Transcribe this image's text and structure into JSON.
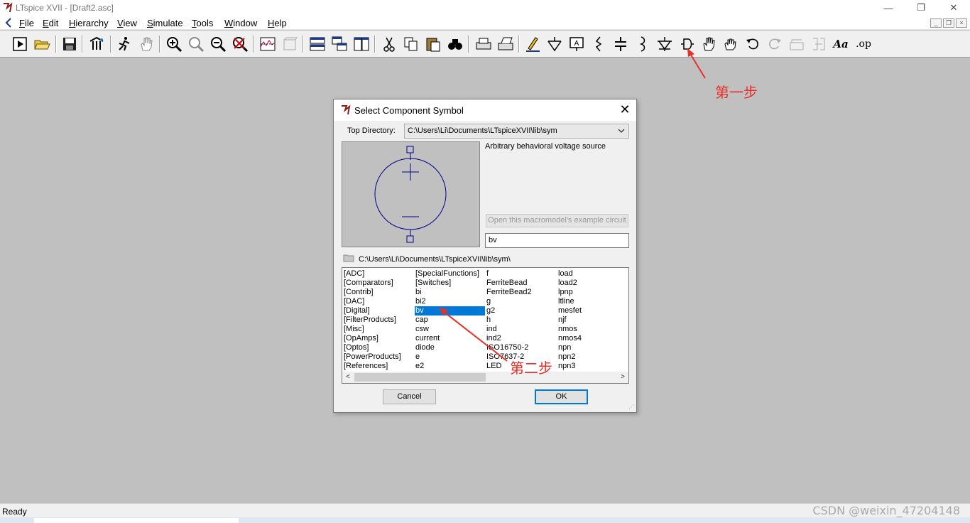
{
  "window": {
    "title": "LTspice XVII - [Draft2.asc]",
    "controls": [
      "—",
      "❐",
      "✕"
    ]
  },
  "menu": {
    "items": [
      "File",
      "Edit",
      "Hierarchy",
      "View",
      "Simulate",
      "Tools",
      "Window",
      "Help"
    ],
    "mdi_controls": [
      "_",
      "❐",
      "×"
    ]
  },
  "toolbar": {
    "tools": [
      {
        "name": "run-icon"
      },
      {
        "name": "open-folder-icon"
      },
      {
        "name": "save-icon"
      },
      {
        "name": "control-panel-icon"
      },
      {
        "name": "autorange-icon"
      },
      {
        "name": "pan-hand-icon"
      },
      {
        "name": "zoom-in-icon"
      },
      {
        "name": "zoom-area-icon"
      },
      {
        "name": "zoom-out-icon"
      },
      {
        "name": "zoom-fit-icon"
      },
      {
        "name": "waveform-icon"
      },
      {
        "name": "waveform-disabled-icon"
      },
      {
        "name": "tile-horizontal-icon"
      },
      {
        "name": "cascade-icon"
      },
      {
        "name": "tile-vertical-icon"
      },
      {
        "name": "cut-icon"
      },
      {
        "name": "copy-icon"
      },
      {
        "name": "paste-icon"
      },
      {
        "name": "find-icon"
      },
      {
        "name": "print-icon"
      },
      {
        "name": "print-setup-icon"
      },
      {
        "name": "draw-wire-icon"
      },
      {
        "name": "ground-icon"
      },
      {
        "name": "label-net-icon"
      },
      {
        "name": "resistor-icon"
      },
      {
        "name": "capacitor-icon"
      },
      {
        "name": "inductor-icon"
      },
      {
        "name": "diode-icon"
      },
      {
        "name": "component-icon"
      },
      {
        "name": "move-icon"
      },
      {
        "name": "drag-icon"
      },
      {
        "name": "undo-icon"
      },
      {
        "name": "redo-icon"
      },
      {
        "name": "rotate-icon"
      },
      {
        "name": "mirror-icon"
      },
      {
        "name": "text-icon"
      },
      {
        "name": "spice-directive-icon"
      }
    ],
    "text_glyph": "Aa",
    "op_glyph": ".op"
  },
  "annotations": {
    "step_one": "第一步",
    "step_two": "第二步",
    "color": "#e8302a"
  },
  "dialog": {
    "title": "Select Component Symbol",
    "top_directory_label": "Top Directory:",
    "top_directory_value": "C:\\Users\\Li\\Documents\\LTspiceXVII\\lib\\sym",
    "description": "Arbitrary behavioral voltage source",
    "macromodel_button": "Open this macromodel's example circuit",
    "name_value": "bv",
    "current_path": "C:\\Users\\Li\\Documents\\LTspiceXVII\\lib\\sym\\",
    "list_columns": [
      [
        "[ADC]",
        "[Comparators]",
        "[Contrib]",
        "[DAC]",
        "[Digital]",
        "[FilterProducts]",
        "[Misc]",
        "[OpAmps]",
        "[Optos]",
        "[PowerProducts]",
        "[References]"
      ],
      [
        "[SpecialFunctions]",
        "[Switches]",
        "bi",
        "bi2",
        "bv",
        "cap",
        "csw",
        "current",
        "diode",
        "e",
        "e2"
      ],
      [
        "f",
        "FerriteBead",
        "FerriteBead2",
        "g",
        "g2",
        "h",
        "ind",
        "ind2",
        "ISO16750-2",
        "ISO7637-2",
        "LED"
      ],
      [
        "load",
        "load2",
        "lpnp",
        "ltline",
        "mesfet",
        "njf",
        "nmos",
        "nmos4",
        "npn",
        "npn2",
        "npn3"
      ]
    ],
    "selected_item": "bv",
    "cancel_label": "Cancel",
    "ok_label": "OK"
  },
  "status": {
    "text": "Ready",
    "watermark": "CSDN @weixin_47204148"
  }
}
